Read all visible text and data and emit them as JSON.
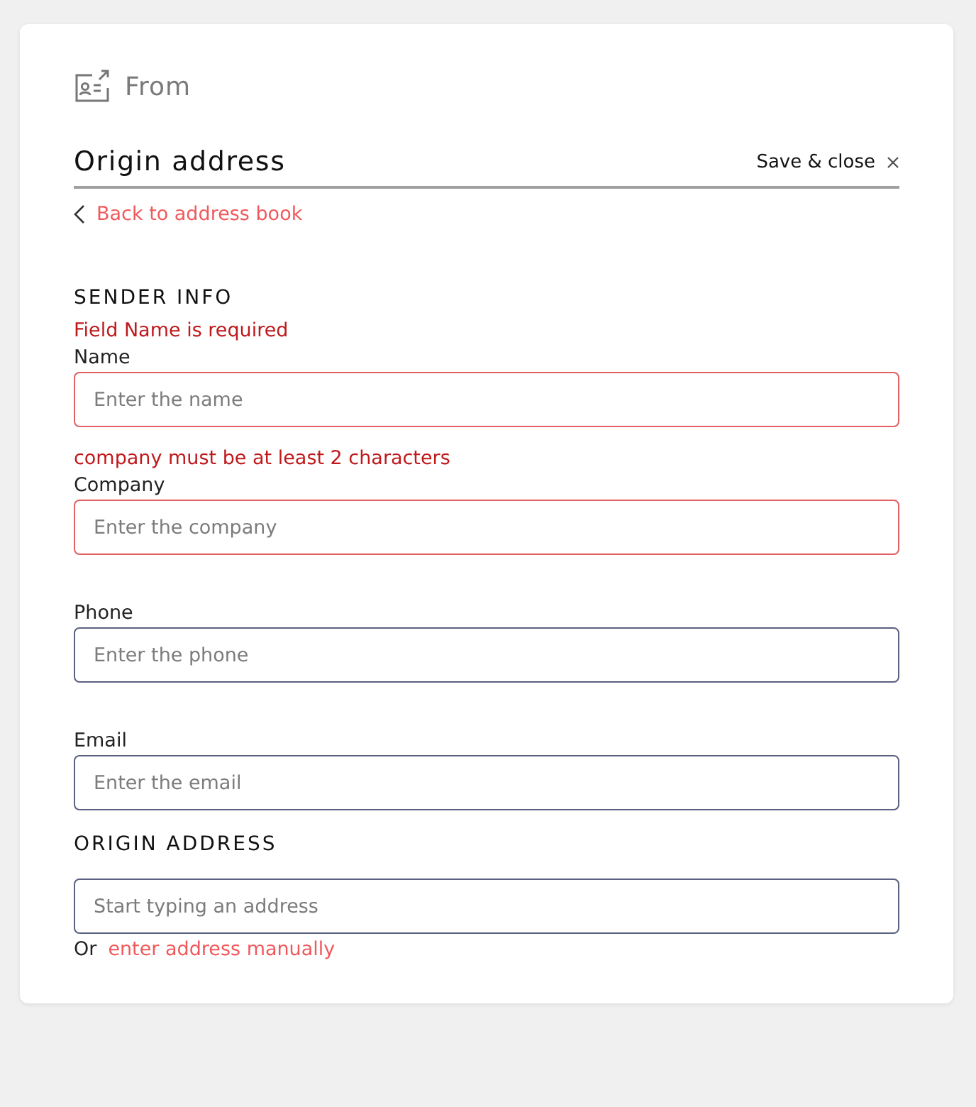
{
  "header": {
    "title": "From"
  },
  "panel": {
    "title": "Origin address",
    "save_close": "Save & close",
    "back_link": "Back to address book"
  },
  "sender_info": {
    "heading": "SENDER INFO",
    "fields": [
      {
        "label": "Name",
        "placeholder": "Enter the name",
        "invalid": true,
        "error": "Field Name is required"
      },
      {
        "label": "Company",
        "placeholder": "Enter the company",
        "invalid": true,
        "error": "company must be at least 2 characters"
      },
      {
        "label": "Phone",
        "placeholder": "Enter the phone",
        "invalid": false
      },
      {
        "label": "Email",
        "placeholder": "Enter the email",
        "invalid": false
      }
    ]
  },
  "origin_address": {
    "heading": "ORIGIN ADDRESS",
    "placeholder": "Start typing an address",
    "or_text": "Or",
    "manual_link": "enter address manually"
  }
}
